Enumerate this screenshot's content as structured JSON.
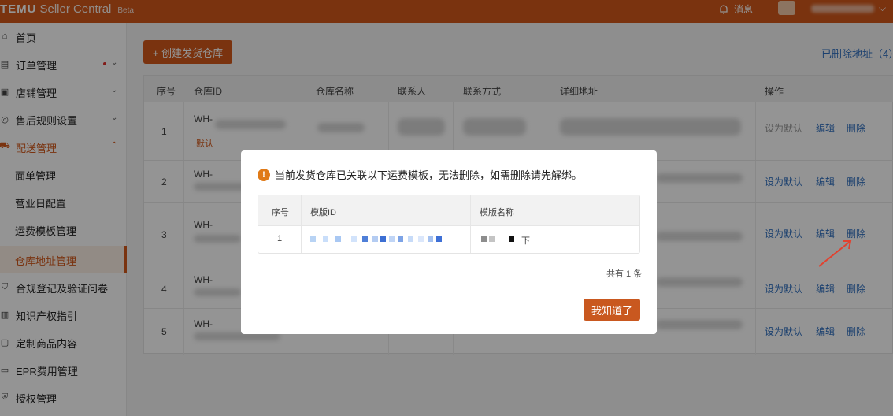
{
  "header": {
    "logo": "TEMU",
    "product": "Seller Central",
    "beta": "Beta",
    "messages_label": "消息"
  },
  "sidebar": {
    "items": [
      {
        "label": "首页",
        "icon": "home-icon"
      },
      {
        "label": "订单管理",
        "icon": "order-icon",
        "has_dot": true
      },
      {
        "label": "店铺管理",
        "icon": "store-icon"
      },
      {
        "label": "售后规则设置",
        "icon": "aftersale-icon"
      },
      {
        "label": "配送管理",
        "icon": "delivery-icon",
        "expanded": true
      },
      {
        "label": "面单管理"
      },
      {
        "label": "营业日配置"
      },
      {
        "label": "运费模板管理"
      },
      {
        "label": "仓库地址管理",
        "active": true
      },
      {
        "label": "合规登记及验证问卷",
        "icon": "shield-icon"
      },
      {
        "label": "知识产权指引",
        "icon": "book-icon"
      },
      {
        "label": "定制商品内容",
        "icon": "customize-icon"
      },
      {
        "label": "EPR费用管理",
        "icon": "epr-icon"
      },
      {
        "label": "授权管理",
        "icon": "auth-icon"
      }
    ]
  },
  "main": {
    "create_button": "+ 创建发货仓库",
    "deleted_link": "已删除地址（4）",
    "table": {
      "headers": [
        "序号",
        "仓库ID",
        "仓库名称",
        "联系人",
        "联系方式",
        "详细地址",
        "操作"
      ],
      "rows": [
        {
          "index": "1",
          "wh_id": "WH-",
          "default_tag": "默认",
          "actions": [
            "设为默认",
            "编辑",
            "删除"
          ],
          "default_disabled": true
        },
        {
          "index": "2",
          "wh_id": "WH-",
          "actions": [
            "设为默认",
            "编辑",
            "删除"
          ]
        },
        {
          "index": "3",
          "wh_id": "WH-",
          "actions": [
            "设为默认",
            "编辑",
            "删除"
          ]
        },
        {
          "index": "4",
          "wh_id": "WH-",
          "actions": [
            "设为默认",
            "编辑",
            "删除"
          ]
        },
        {
          "index": "5",
          "wh_id": "WH-",
          "actions": [
            "设为默认",
            "编辑",
            "删除"
          ]
        }
      ]
    }
  },
  "modal": {
    "message": "当前发货仓库已关联以下运费模板，无法删除，如需删除请先解绑。",
    "table": {
      "headers": [
        "序号",
        "模版ID",
        "模版名称"
      ],
      "rows": [
        {
          "index": "1",
          "name_suffix": "下"
        }
      ]
    },
    "total": "共有 1 条",
    "confirm_button": "我知道了"
  },
  "colors": {
    "brand": "#d2581a",
    "link": "#2f6fbf"
  }
}
